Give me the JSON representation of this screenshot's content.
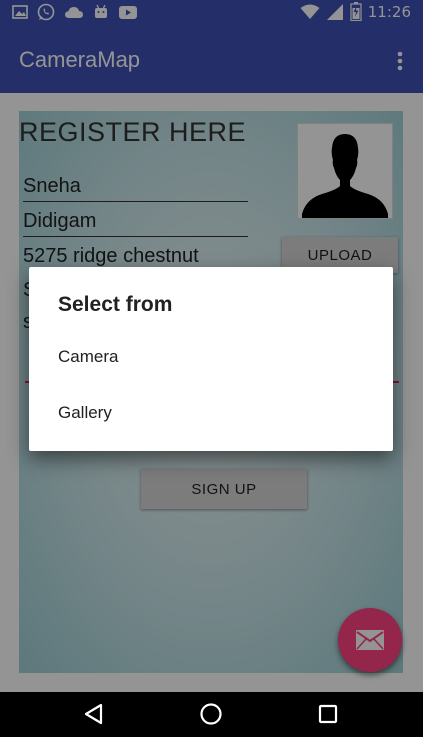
{
  "status_bar": {
    "time": "11:26",
    "left_icons": [
      "image-icon",
      "whatsapp-icon",
      "cloud-icon",
      "android-icon",
      "youtube-icon"
    ],
    "right_icons": [
      "wifi-icon",
      "signal-icon",
      "battery-icon"
    ]
  },
  "app_bar": {
    "title": "CameraMap",
    "overflow_icon": "more-vert-icon"
  },
  "form": {
    "title": "REGISTER HERE",
    "first_name": "Sneha",
    "last_name": "Didigam",
    "address": "5275 ridge chestnut",
    "field4_partial": "S",
    "field5_partial": "s",
    "upload_label": "UPLOAD",
    "signup_label": "SIGN UP",
    "fab_icon": "email-icon"
  },
  "dialog": {
    "title": "Select from",
    "options": [
      "Camera",
      "Gallery"
    ]
  },
  "nav_bar": {
    "icons": [
      "back-icon",
      "home-icon",
      "recents-icon"
    ]
  },
  "colors": {
    "primary": "#3f51b5",
    "accent": "#ff4081",
    "form_bg": "#c8e6ea"
  }
}
